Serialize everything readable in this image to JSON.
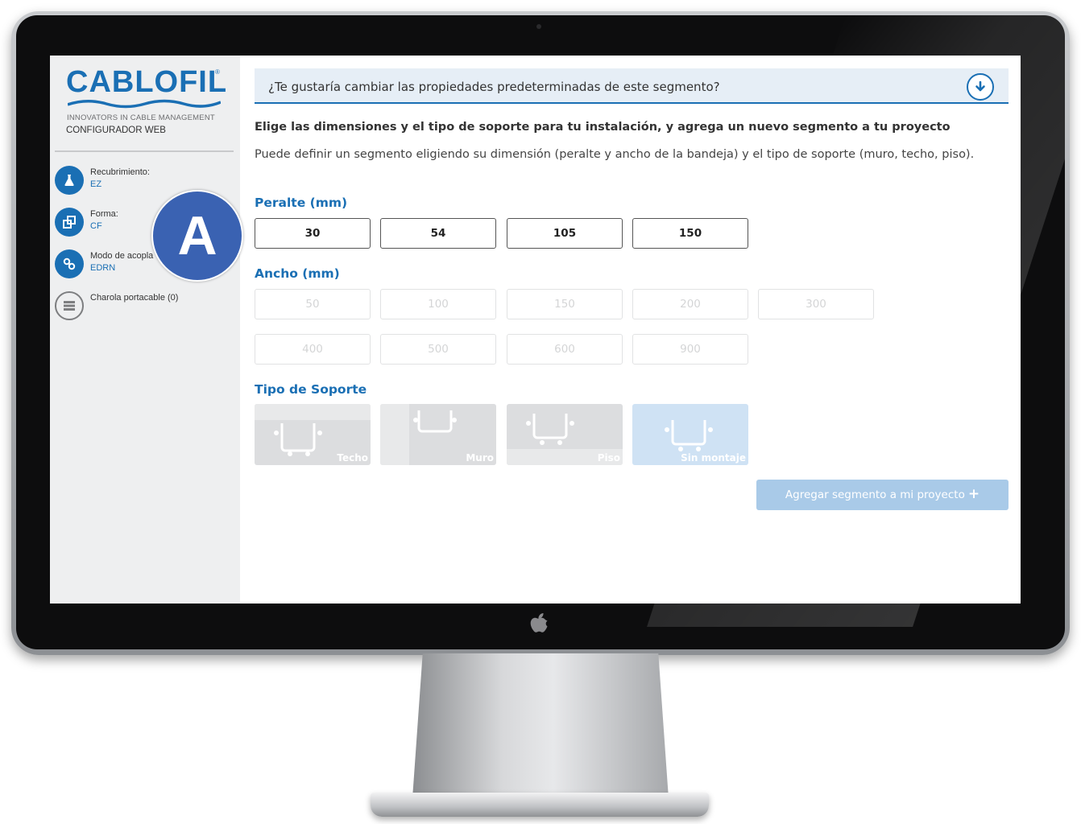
{
  "brand": {
    "name": "CABLOFIL",
    "registered_mark": "®",
    "tagline": "INNOVATORS IN CABLE MANAGEMENT",
    "subtitle": "CONFIGURADOR WEB",
    "accent_color": "#1a6fb4"
  },
  "sidebar": {
    "items": [
      {
        "label": "Recubrimiento:",
        "value": "EZ",
        "icon": "flask-icon",
        "active": true
      },
      {
        "label": "Forma:",
        "value": "CF",
        "icon": "shapes-icon",
        "active": true
      },
      {
        "label": "Modo de acopla",
        "value": "EDRN",
        "icon": "link-icon",
        "active": true
      },
      {
        "label": "Charola portacable (0)",
        "value": "",
        "icon": "tray-icon",
        "active": false
      }
    ]
  },
  "banner": {
    "text": "¿Te gustaría cambiar las propiedades predeterminadas de este segmento?",
    "toggle_icon": "arrow-down-circle-icon"
  },
  "main": {
    "headline": "Elige las dimensiones y el tipo de soporte para tu instalación, y agrega un nuevo segmento a tu proyecto",
    "intro": "Puede definir un segmento eligiendo su dimensión (peralte y ancho de la bandeja) y el tipo de soporte (muro, techo, piso).",
    "peralte": {
      "title": "Peralte (mm)",
      "options": [
        "30",
        "54",
        "105",
        "150"
      ]
    },
    "ancho": {
      "title": "Ancho (mm)",
      "options": [
        "50",
        "100",
        "150",
        "200",
        "300",
        "400",
        "500",
        "600",
        "900"
      ],
      "state": "disabled"
    },
    "soporte": {
      "title": "Tipo de Soporte",
      "options": [
        "Techo",
        "Muro",
        "Piso",
        "Sin montaje"
      ],
      "highlighted": "Sin montaje"
    },
    "add_button": {
      "label": "Agregar segmento a mi proyecto",
      "icon": "plus-icon",
      "state": "disabled"
    }
  },
  "annotation": {
    "label": "A",
    "color": "#3a62b2"
  }
}
